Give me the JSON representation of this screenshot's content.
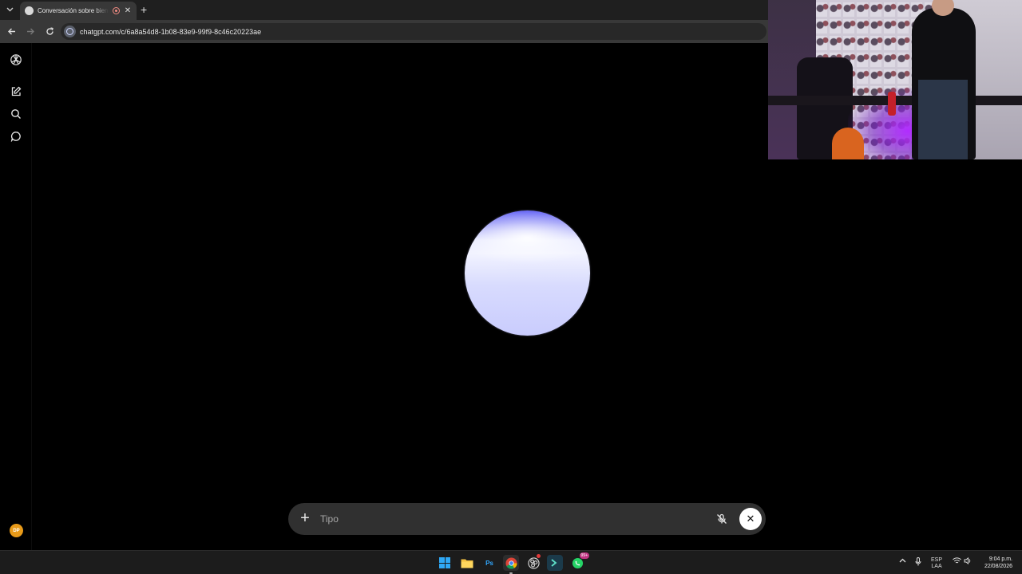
{
  "browser": {
    "tab_title": "Conversación sobre bienestar",
    "url": "chatgpt.com/c/6a8a54d8-1b08-83e9-99f9-8c46c20223ae",
    "icons": {
      "tab_list": "chevron-down-icon",
      "recording": "recording-icon",
      "close_tab": "close-icon",
      "new_tab": "plus-icon",
      "back": "arrow-left-icon",
      "forward": "arrow-right-icon",
      "reload": "reload-icon",
      "site_info": "site-info-icon"
    }
  },
  "sidebar": {
    "logo": "openai-logo-icon",
    "items": [
      {
        "name": "new-chat",
        "icon": "edit-icon"
      },
      {
        "name": "search",
        "icon": "search-icon"
      },
      {
        "name": "chats",
        "icon": "chat-bubble-icon"
      }
    ],
    "avatar_initials": "DP"
  },
  "voice_mode": {
    "orb_colors": [
      "#6b6bf5",
      "#f2f3ff",
      "#c9ccfd"
    ]
  },
  "composer": {
    "placeholder": "Tipo",
    "add_icon": "plus-icon",
    "mute_icon": "mic-off-icon",
    "end_icon": "close-icon"
  },
  "taskbar": {
    "apps": [
      "windows-start-icon",
      "file-explorer-icon",
      "photoshop-icon",
      "chrome-icon",
      "obs-icon",
      "terminal-icon",
      "whatsapp-icon"
    ],
    "photoshop_label": "Ps",
    "whatsapp_badge": "99+",
    "tray": {
      "language_top": "ESP",
      "language_bottom": "LAA",
      "time": "9:04 p.m.",
      "date": "22/08/2026"
    }
  }
}
